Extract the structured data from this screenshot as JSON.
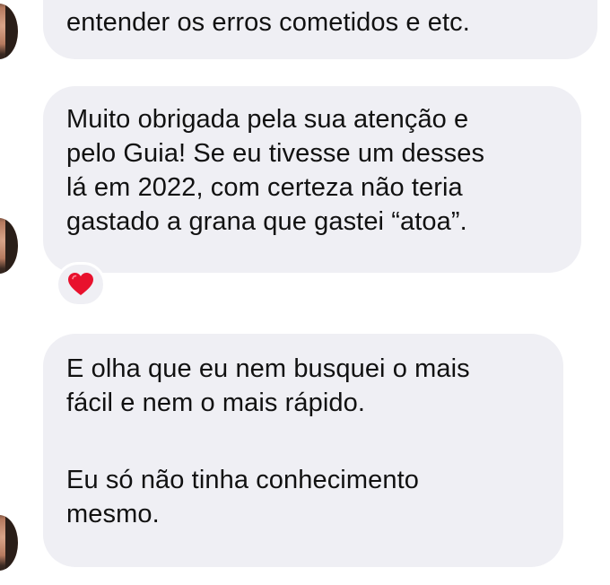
{
  "messages": [
    {
      "lines": [
        "entender os erros cometidos e etc."
      ]
    },
    {
      "lines": [
        "Muito obrigada pela sua atenção e",
        "pelo Guia! Se eu tivesse um desses",
        "lá em 2022, com certeza não teria",
        "gastado a grana que gastei “atoa”."
      ],
      "reaction": "heart-icon"
    },
    {
      "paragraph1": [
        "E olha que eu nem busquei o mais",
        "fácil e nem o mais rápido."
      ],
      "paragraph2": [
        "Eu só não tinha conhecimento",
        "mesmo."
      ]
    }
  ],
  "colors": {
    "bubble": "#efeff4",
    "text": "#111111",
    "heart": "#e8112d"
  }
}
